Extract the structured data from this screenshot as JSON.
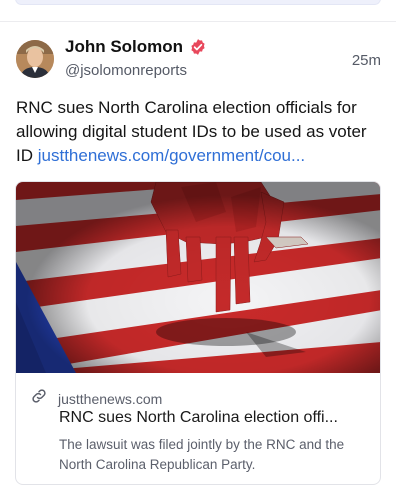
{
  "post": {
    "author_name": "John Solomon",
    "handle": "@jsolomonreports",
    "time": "25m",
    "text": "RNC sues North Carolina election officials for allowing digital student IDs to be used as voter ID ",
    "link_text": "justthenews.com/government/cou..."
  },
  "card": {
    "domain": "justthenews.com",
    "title": "RNC sues North Carolina election offi...",
    "description": "The lawsuit was filed jointly by the RNC and the North Carolina Republican Party."
  },
  "icons": {
    "verified": "verified-badge-icon",
    "link": "link-icon"
  },
  "colors": {
    "link": "#2f6fd6",
    "verified_badge": "#e8485c",
    "muted_text": "#555a66"
  }
}
